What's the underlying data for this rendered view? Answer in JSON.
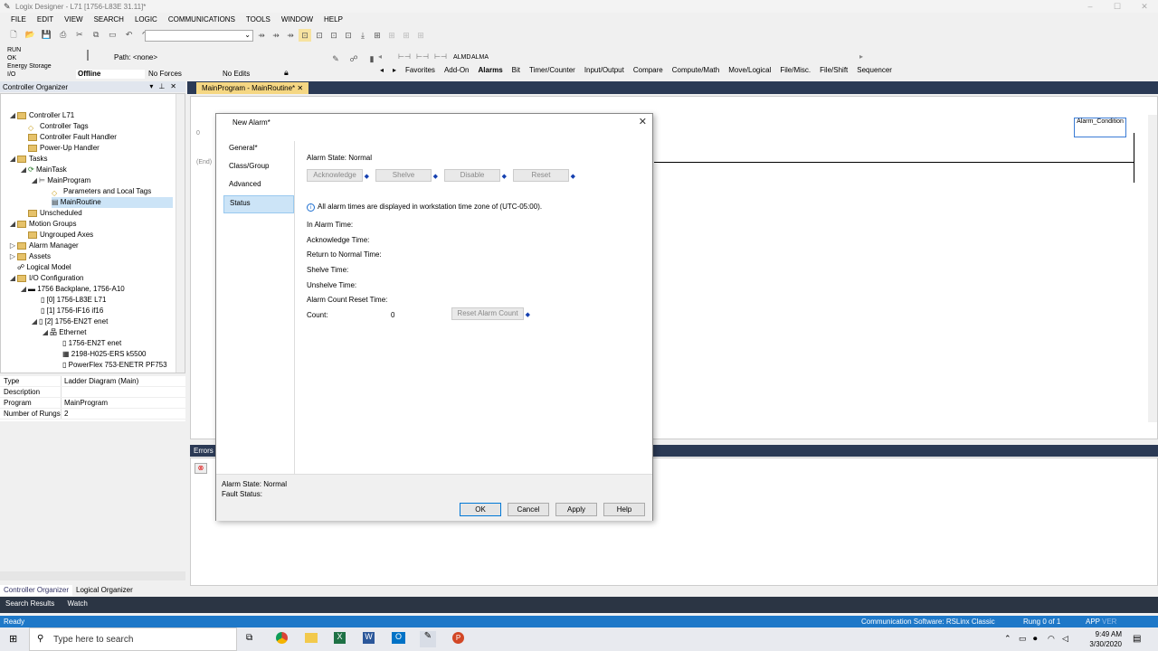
{
  "window": {
    "title": "Logix Designer - L71 [1756-L83E 31.11]*"
  },
  "menu": [
    "FILE",
    "EDIT",
    "VIEW",
    "SEARCH",
    "LOGIC",
    "COMMUNICATIONS",
    "TOOLS",
    "WINDOW",
    "HELP"
  ],
  "status_panel": {
    "run": "RUN",
    "ok": "OK",
    "energy": "Energy Storage",
    "io": "I/O",
    "mode": "Offline",
    "forces": "No Forces",
    "edits": "No Edits",
    "path": "Path: <none>"
  },
  "ladder_tabs": [
    "Favorites",
    "Add-On",
    "Alarms",
    "Bit",
    "Timer/Counter",
    "Input/Output",
    "Compare",
    "Compute/Math",
    "Move/Logical",
    "File/Misc.",
    "File/Shift",
    "Sequencer"
  ],
  "ladder_labels": {
    "almd": "ALMD",
    "alma": "ALMA"
  },
  "organizer": {
    "title": "Controller Organizer",
    "items": [
      {
        "label": "Controller L71",
        "type": "folder"
      },
      {
        "label": "Controller Tags",
        "type": "tag"
      },
      {
        "label": "Controller Fault Handler",
        "type": "folder"
      },
      {
        "label": "Power-Up Handler",
        "type": "folder"
      },
      {
        "label": "Tasks",
        "type": "folder"
      },
      {
        "label": "MainTask",
        "type": "task"
      },
      {
        "label": "MainProgram",
        "type": "program"
      },
      {
        "label": "Parameters and Local Tags",
        "type": "tag"
      },
      {
        "label": "MainRoutine",
        "type": "routine"
      },
      {
        "label": "Unscheduled",
        "type": "folder"
      },
      {
        "label": "Motion Groups",
        "type": "folder"
      },
      {
        "label": "Ungrouped Axes",
        "type": "folder"
      },
      {
        "label": "Alarm Manager",
        "type": "folder"
      },
      {
        "label": "Assets",
        "type": "folder"
      },
      {
        "label": "Logical Model",
        "type": "model"
      },
      {
        "label": "I/O Configuration",
        "type": "folder"
      },
      {
        "label": "1756 Backplane, 1756-A10",
        "type": "rack"
      },
      {
        "label": "[0] 1756-L83E L71",
        "type": "module"
      },
      {
        "label": "[1] 1756-IF16 if16",
        "type": "module"
      },
      {
        "label": "[2] 1756-EN2T enet",
        "type": "module"
      },
      {
        "label": "Ethernet",
        "type": "net"
      },
      {
        "label": "1756-EN2T enet",
        "type": "module"
      },
      {
        "label": "2198-H025-ERS k5500",
        "type": "module"
      },
      {
        "label": "PowerFlex 753-ENETR PF753",
        "type": "module"
      }
    ]
  },
  "properties": [
    {
      "k": "Type",
      "v": "Ladder Diagram (Main)"
    },
    {
      "k": "Description",
      "v": ""
    },
    {
      "k": "Program",
      "v": "MainProgram"
    },
    {
      "k": "Number of Rungs",
      "v": "2"
    }
  ],
  "org_tabs": [
    "Controller Organizer",
    "Logical Organizer"
  ],
  "bottom_tabs": [
    "Search Results",
    "Watch"
  ],
  "doc_tab": "MainProgram - MainRoutine*",
  "editor": {
    "rung0": "0",
    "end": "(End)",
    "alarm_box": "Alarm_Condition"
  },
  "errors_title": "Errors",
  "statusbar": {
    "ready": "Ready",
    "comm": "Communication Software: RSLinx Classic",
    "rung": "Rung 0 of 1",
    "app": "APP",
    "ver": "VER"
  },
  "taskbar": {
    "search_placeholder": "Type here to search",
    "time": "9:49 AM",
    "date": "3/30/2020"
  },
  "dialog": {
    "title": "New Alarm*",
    "nav": [
      "General*",
      "Class/Group",
      "Advanced",
      "Status"
    ],
    "alarm_state_label": "Alarm State:",
    "alarm_state_value": "Normal",
    "buttons": [
      "Acknowledge",
      "Shelve",
      "Disable",
      "Reset"
    ],
    "info": "All alarm times are displayed in workstation time zone of (UTC-05:00).",
    "fields": [
      "In Alarm Time:",
      "Acknowledge Time:",
      "Return to Normal Time:",
      "Shelve Time:",
      "Unshelve Time:",
      "Alarm Count Reset Time:",
      "Count:"
    ],
    "count_value": "0",
    "reset_count": "Reset Alarm Count",
    "footer_state": "Alarm State: Normal",
    "footer_fault": "Fault Status:",
    "ok": "OK",
    "cancel": "Cancel",
    "apply": "Apply",
    "help": "Help"
  }
}
